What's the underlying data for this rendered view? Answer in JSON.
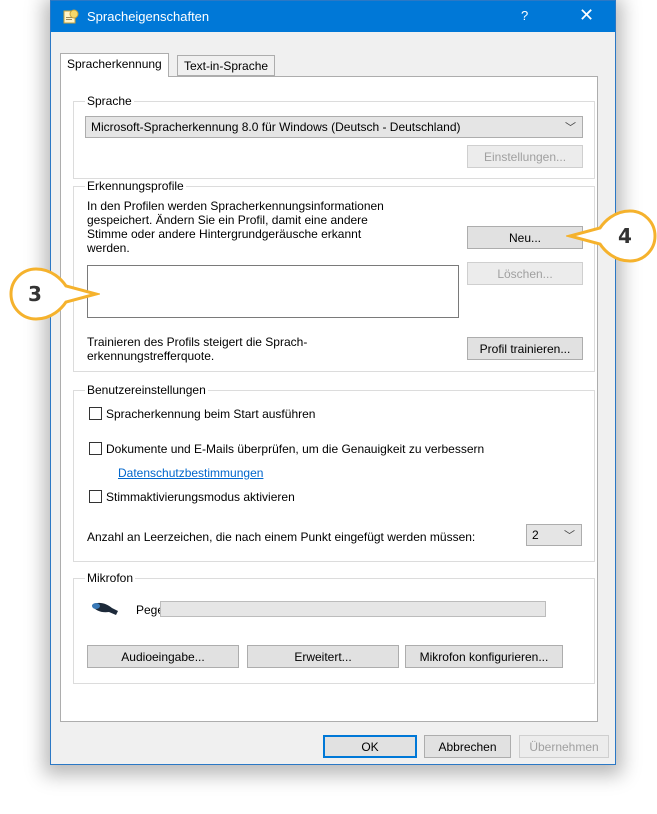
{
  "window": {
    "title": "Spracheigenschaften",
    "help": "?",
    "close": "✕"
  },
  "tabs": [
    {
      "label": "Spracherkennung",
      "active": true
    },
    {
      "label": "Text-in-Sprache",
      "active": false
    }
  ],
  "language": {
    "group_label": "Sprache",
    "selected": "Microsoft-Spracherkennung 8.0 für Windows (Deutsch - Deutschland)",
    "settings_button": "Einstellungen..."
  },
  "profiles": {
    "group_label": "Erkennungsprofile",
    "description": "In den Profilen werden Spracherkennungsinformationen gespeichert. Ändern Sie ein Profil, damit eine andere Stimme oder andere Hintergrundgeräusche erkannt werden.",
    "new_button": "Neu...",
    "delete_button": "Löschen...",
    "training_text": "Trainieren des Profils steigert die Sprach-erkennungstrefferquote.",
    "train_button": "Profil trainieren..."
  },
  "user_settings": {
    "group_label": "Benutzereinstellungen",
    "run_at_startup": {
      "label": "Spracherkennung beim Start ausführen",
      "checked": false
    },
    "review_docs": {
      "label": "Dokumente und E-Mails überprüfen, um die Genauigkeit zu verbessern",
      "checked": false
    },
    "privacy_link": "Datenschutzbestimmungen",
    "voice_activation": {
      "label": "Stimmaktivierungsmodus aktivieren",
      "checked": false
    },
    "spaces_label": "Anzahl an Leerzeichen, die nach einem Punkt eingefügt werden müssen:",
    "spaces_value": "2"
  },
  "microphone": {
    "group_label": "Mikrofon",
    "level_label": "Pegel",
    "level": 0,
    "audio_input_button": "Audioeingabe...",
    "advanced_button": "Erweitert...",
    "configure_button": "Mikrofon konfigurieren..."
  },
  "footer": {
    "ok": "OK",
    "cancel": "Abbrechen",
    "apply": "Übernehmen"
  },
  "callouts": [
    "3",
    "4"
  ],
  "colors": {
    "titlebar": "#0078d7",
    "callout_border": "#f5b22d",
    "link": "#0066cc"
  }
}
